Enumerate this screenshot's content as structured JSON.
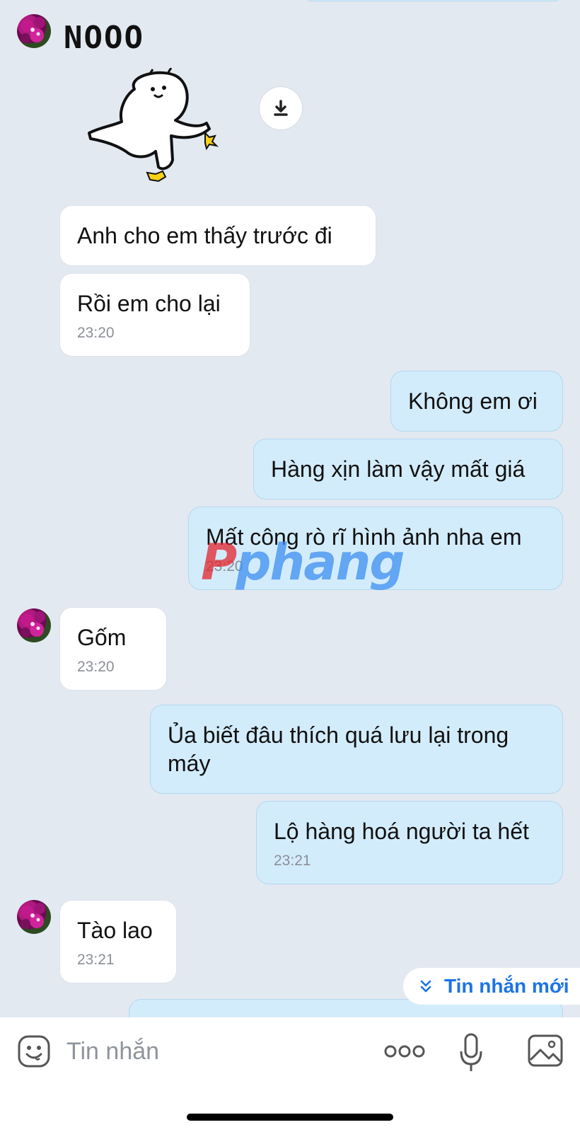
{
  "colors": {
    "background": "#e3e9f1",
    "incoming_bubble": "#ffffff",
    "outgoing_bubble": "#d3ecfb",
    "accent": "#1b74e6",
    "timestamp": "#8a8f97"
  },
  "sticker": {
    "text": "NOOO",
    "icon": "kicking-cat-sticker"
  },
  "messages": [
    {
      "direction": "in",
      "text": "Anh cho em thấy trước đi"
    },
    {
      "direction": "in",
      "text": "Rồi em cho lại",
      "time": "23:20"
    },
    {
      "direction": "out",
      "text": "Không em ơi"
    },
    {
      "direction": "out",
      "text": "Hàng xịn làm vậy mất giá"
    },
    {
      "direction": "out",
      "text": "Mất công rò rĩ hình ảnh nha em",
      "time": "23:20"
    },
    {
      "direction": "in",
      "text": "Gốm",
      "time": "23:20"
    },
    {
      "direction": "out",
      "text": "Ủa biết đâu thích quá lưu lại trong máy"
    },
    {
      "direction": "out",
      "text": "Lộ hàng hoá người ta hết",
      "time": "23:21"
    },
    {
      "direction": "in",
      "text": "Tào lao",
      "time": "23:21"
    }
  ],
  "watermark": {
    "part1": "P",
    "part2": "phang"
  },
  "new_messages_button": {
    "label": "Tin nhắn mới",
    "icon": "double-chevron-down-icon"
  },
  "composer": {
    "placeholder": "Tin nhắn",
    "icons": [
      "emoji-icon",
      "more-icon",
      "microphone-icon",
      "image-icon"
    ]
  }
}
